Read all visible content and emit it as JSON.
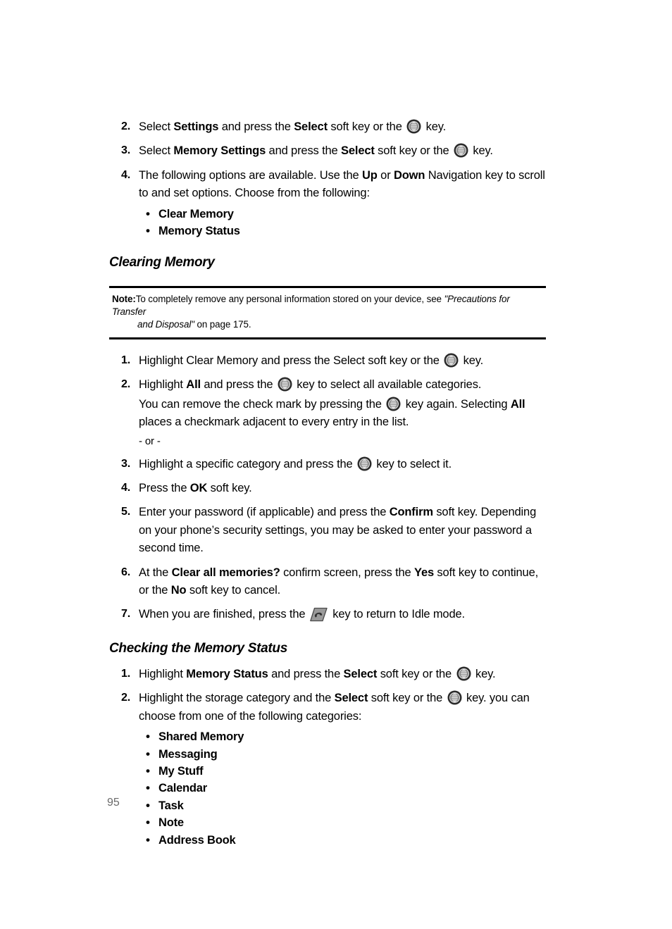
{
  "document": {
    "page_number": "95",
    "icons": {
      "ok_key": "ok-key-icon",
      "end_call_key": "end-call-key-icon"
    }
  },
  "top_steps": [
    {
      "number": "2.",
      "parts": [
        {
          "t": "Select ",
          "b": false
        },
        {
          "t": "Settings",
          "b": true
        },
        {
          "t": " and press the ",
          "b": false
        },
        {
          "t": "Select",
          "b": true
        },
        {
          "t": " soft key or the ",
          "b": false
        },
        {
          "t": "[okkey]",
          "b": false
        },
        {
          "t": " key.",
          "b": false
        }
      ]
    },
    {
      "number": "3.",
      "parts": [
        {
          "t": "Select ",
          "b": false
        },
        {
          "t": "Memory Settings",
          "b": true
        },
        {
          "t": " and press the ",
          "b": false
        },
        {
          "t": "Select",
          "b": true
        },
        {
          "t": " soft key or the ",
          "b": false
        },
        {
          "t": "[okkey]",
          "b": false
        },
        {
          "t": " key.",
          "b": false
        }
      ]
    },
    {
      "number": "4.",
      "parts": [
        {
          "t": "The following options are available. Use the ",
          "b": false
        },
        {
          "t": "Up",
          "b": true
        },
        {
          "t": " or ",
          "b": false
        },
        {
          "t": "Down",
          "b": true
        },
        {
          "t": " Navigation key to scroll to and set options. Choose from the following:",
          "b": false
        }
      ],
      "bullets": [
        "Clear Memory",
        "Memory Status"
      ]
    }
  ],
  "clearing_memory": {
    "heading": "Clearing Memory",
    "note": {
      "label": "Note:",
      "line1_a": "To completely remove any personal information stored on your device, see ",
      "line1_italic": "\"Precautions for Transfer",
      "line2_italic": "and Disposal\"",
      "line2_b": "  on page 175."
    },
    "steps": [
      {
        "number": "1.",
        "parts": [
          {
            "t": "Highlight Clear Memory and press the Select soft key or the ",
            "b": false
          },
          {
            "t": "[okkey]",
            "b": false
          },
          {
            "t": " key.",
            "b": false
          }
        ]
      },
      {
        "number": "2.",
        "parts": [
          {
            "t": "Highlight ",
            "b": false
          },
          {
            "t": "All",
            "b": true
          },
          {
            "t": " and press the ",
            "b": false
          },
          {
            "t": "[okkey]",
            "b": false
          },
          {
            "t": " key to select all available categories.",
            "b": false
          }
        ],
        "extra_paras": [
          [
            {
              "t": "You can remove the check mark by pressing the ",
              "b": false
            },
            {
              "t": "[okkey]",
              "b": false
            },
            {
              "t": " key again. Selecting ",
              "b": false
            },
            {
              "t": "All",
              "b": true
            },
            {
              "t": " places a checkmark adjacent to every entry in the list.",
              "b": false
            }
          ],
          [
            {
              "t": "- or -",
              "b": false,
              "small": true
            }
          ]
        ]
      },
      {
        "number": "3.",
        "parts": [
          {
            "t": "Highlight a specific category and press the ",
            "b": false
          },
          {
            "t": "[okkey]",
            "b": false
          },
          {
            "t": " key to select it.",
            "b": false
          }
        ]
      },
      {
        "number": "4.",
        "parts": [
          {
            "t": "Press the ",
            "b": false
          },
          {
            "t": "OK",
            "b": true
          },
          {
            "t": " soft key.",
            "b": false
          }
        ]
      },
      {
        "number": "5.",
        "parts": [
          {
            "t": "Enter your password (if applicable) and press the ",
            "b": false
          },
          {
            "t": "Confirm",
            "b": true
          },
          {
            "t": " soft key. Depending on your phone’s security settings, you may be asked to enter your password a second time.",
            "b": false
          }
        ]
      },
      {
        "number": "6.",
        "parts": [
          {
            "t": "At the ",
            "b": false
          },
          {
            "t": "Clear all memories?",
            "b": true
          },
          {
            "t": " confirm screen, press the ",
            "b": false
          },
          {
            "t": "Yes",
            "b": true
          },
          {
            "t": " soft key to continue, or the ",
            "b": false
          },
          {
            "t": "No",
            "b": true
          },
          {
            "t": " soft key to cancel.",
            "b": false
          }
        ]
      },
      {
        "number": "7.",
        "parts": [
          {
            "t": "When you are finished, press the ",
            "b": false
          },
          {
            "t": "[endkey]",
            "b": false
          },
          {
            "t": " key to return to Idle mode.",
            "b": false
          }
        ]
      }
    ]
  },
  "checking_status": {
    "heading": "Checking the Memory Status",
    "steps": [
      {
        "number": "1.",
        "parts": [
          {
            "t": "Highlight ",
            "b": false
          },
          {
            "t": "Memory Status",
            "b": true
          },
          {
            "t": " and press the ",
            "b": false
          },
          {
            "t": "Select",
            "b": true
          },
          {
            "t": " soft key or the ",
            "b": false
          },
          {
            "t": "[okkey]",
            "b": false
          },
          {
            "t": " key.",
            "b": false
          }
        ]
      },
      {
        "number": "2.",
        "parts": [
          {
            "t": "Highlight the storage category and the ",
            "b": false
          },
          {
            "t": "Select",
            "b": true
          },
          {
            "t": " soft key or the ",
            "b": false
          },
          {
            "t": "[okkey]",
            "b": false
          },
          {
            "t": " key. you can choose from one of the following categories:",
            "b": false
          }
        ],
        "bullets": [
          "Shared Memory",
          "Messaging",
          "My Stuff",
          "Calendar",
          "Task",
          "Note",
          "Address Book"
        ]
      }
    ]
  }
}
